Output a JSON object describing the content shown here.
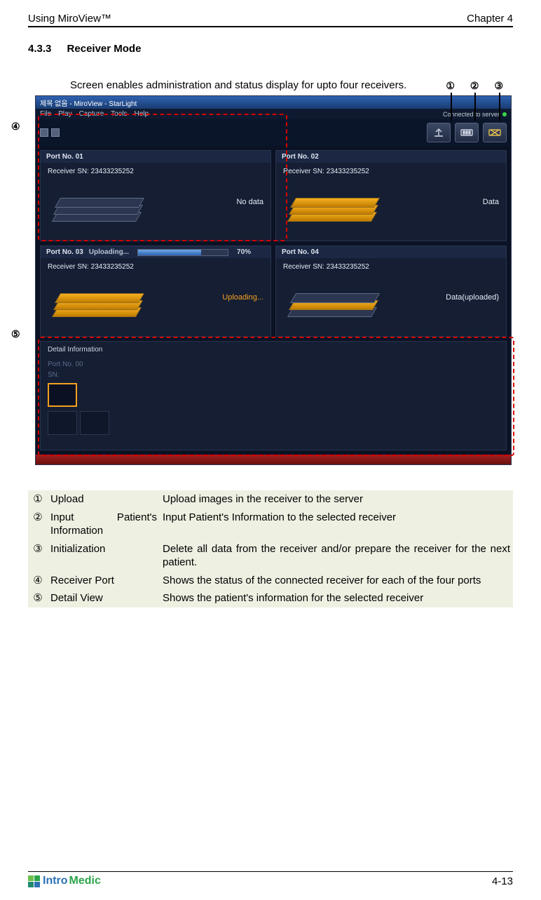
{
  "header": {
    "left": "Using MiroView™",
    "right": "Chapter 4"
  },
  "section": {
    "number": "4.3.3",
    "title": "Receiver Mode"
  },
  "intro": "Screen enables administration and status display for upto four receivers.",
  "callouts": {
    "c1": "①",
    "c2": "②",
    "c3": "③",
    "c4": "④",
    "c5": "⑤"
  },
  "app": {
    "title": "제목 없음 - MiroView - StarLight",
    "menu": {
      "file": "File",
      "play": "Play",
      "capture": "Capture",
      "tools": "Tools",
      "help": "Help"
    },
    "status": "Connected to server",
    "ports": {
      "p1": {
        "title": "Port No. 01",
        "sn": "Receiver SN: 23433235252",
        "status": "No data"
      },
      "p2": {
        "title": "Port No. 02",
        "sn": "Receiver SN: 23433235252",
        "status": "Data"
      },
      "p3": {
        "title": "Port No. 03",
        "sn": "Receiver SN: 23433235252",
        "upload_label": "Uploading...",
        "pct": "70%",
        "status": "Uploading..."
      },
      "p4": {
        "title": "Port No. 04",
        "sn": "Receiver SN: 23433235252",
        "status": "Data(uploaded)"
      }
    },
    "detail": {
      "title": "Detail Information",
      "port": "Port No. 00",
      "sn": "SN:"
    }
  },
  "legend": {
    "r1": {
      "idx": "①",
      "label": "Upload",
      "desc": "Upload images in the receiver to the server"
    },
    "r2": {
      "idx": "②",
      "label": "Input Patient's Information",
      "desc": "Input Patient's Information to the selected receiver"
    },
    "r3": {
      "idx": "③",
      "label": "Initialization",
      "desc": "Delete all data from the receiver and/or prepare the receiver for the next patient."
    },
    "r4": {
      "idx": "④",
      "label": "Receiver Port",
      "desc": "Shows the status of the connected receiver for each of the four ports"
    },
    "r5": {
      "idx": "⑤",
      "label": "Detail View",
      "desc": "Shows the patient's information for the selected receiver"
    }
  },
  "footer": {
    "logo_a": "Intro",
    "logo_b": "Medic",
    "page": "4-13"
  }
}
